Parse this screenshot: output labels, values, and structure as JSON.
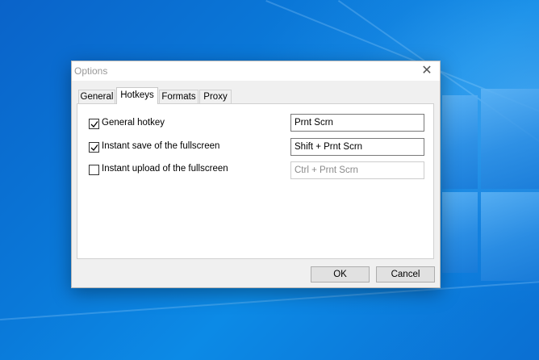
{
  "window": {
    "title": "Options",
    "close_glyph": "✕"
  },
  "tabs": [
    {
      "label": "General",
      "active": false
    },
    {
      "label": "Hotkeys",
      "active": true
    },
    {
      "label": "Formats",
      "active": false
    },
    {
      "label": "Proxy",
      "active": false
    }
  ],
  "hotkeys": [
    {
      "label": "General hotkey",
      "checked": true,
      "value": "Prnt Scrn",
      "enabled": true
    },
    {
      "label": "Instant save of the fullscreen",
      "checked": true,
      "value": "Shift + Prnt Scrn",
      "enabled": true
    },
    {
      "label": "Instant upload of the fullscreen",
      "checked": false,
      "value": "Ctrl + Prnt Scrn",
      "enabled": false
    }
  ],
  "buttons": {
    "ok": "OK",
    "cancel": "Cancel"
  },
  "icons": {
    "close": "close-icon",
    "check": "checkmark-icon"
  },
  "colors": {
    "desktop_accent": "#0a78d8",
    "dialog_bg": "#f0f0f0",
    "title_text": "#999999"
  }
}
